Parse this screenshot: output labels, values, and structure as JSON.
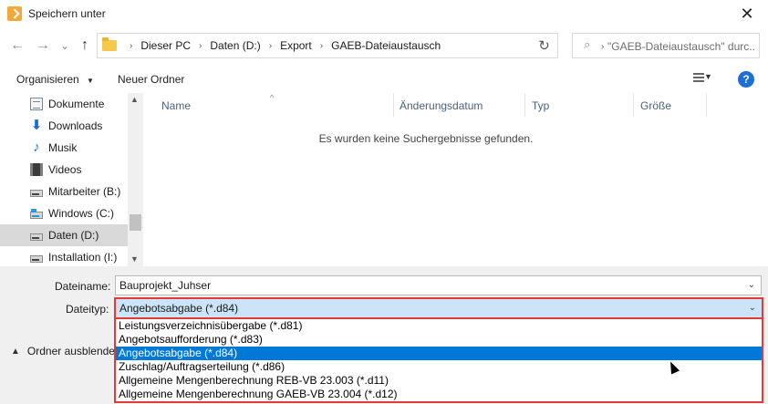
{
  "window": {
    "title": "Speichern unter",
    "close_symbol": "✕"
  },
  "navigation": {
    "back_symbol": "←",
    "forward_symbol": "→",
    "recent_symbol": "⌄",
    "up_symbol": "↑",
    "breadcrumbs": [
      "Dieser PC",
      "Daten (D:)",
      "Export",
      "GAEB-Dateiaustausch"
    ],
    "crumb_separator": "›",
    "refresh_symbol": "↻",
    "search_placeholder": "\"GAEB-Dateiaustausch\" durc...",
    "search_icon_symbol": "⌕"
  },
  "toolbar": {
    "organize_label": "Organisieren",
    "organize_caret": "▼",
    "new_folder_label": "Neuer Ordner",
    "view_caret": "▼",
    "help_symbol": "?"
  },
  "sidebar": {
    "items": [
      {
        "label": "Dokumente",
        "icon": "document-icon"
      },
      {
        "label": "Downloads",
        "icon": "download-icon"
      },
      {
        "label": "Musik",
        "icon": "music-icon"
      },
      {
        "label": "Videos",
        "icon": "video-icon"
      },
      {
        "label": "Mitarbeiter (B:)",
        "icon": "network-drive-icon"
      },
      {
        "label": "Windows (C:)",
        "icon": "windows-drive-icon"
      },
      {
        "label": "Daten (D:)",
        "icon": "drive-icon",
        "selected": true
      },
      {
        "label": "Installation (I:)",
        "icon": "network-drive-icon"
      }
    ],
    "scroll_up_symbol": "▲",
    "scroll_down_symbol": "▼"
  },
  "file_list": {
    "columns": [
      "Name",
      "Änderungsdatum",
      "Typ",
      "Größe"
    ],
    "sort_indicator": "^",
    "empty_message": "Es wurden keine Suchergebnisse gefunden."
  },
  "form": {
    "filename_label": "Dateiname:",
    "filename_value": "Bauprojekt_Juhser",
    "filetype_label": "Dateityp:",
    "filetype_value": "Angebotsabgabe (*.d84)",
    "dropdown_caret": "⌄",
    "hide_folders_label": "Ordner ausblende",
    "hide_folders_caret": "▲"
  },
  "filetype_options": [
    {
      "label": "Leistungsverzeichnisübergabe (*.d81)",
      "selected": false
    },
    {
      "label": "Angebotsaufforderung (*.d83)",
      "selected": false
    },
    {
      "label": "Angebotsabgabe (*.d84)",
      "selected": true
    },
    {
      "label": "Zuschlag/Auftragserteilung (*.d86)",
      "selected": false
    },
    {
      "label": "Allgemeine Mengenberechnung REB-VB 23.003 (*.d11)",
      "selected": false
    },
    {
      "label": "Allgemeine Mengenberechnung GAEB-VB 23.004 (*.d12)",
      "selected": false
    }
  ],
  "colors": {
    "accent": "#0078d7",
    "highlight_border": "#e03b3b",
    "selected_field": "#cce4f7"
  }
}
